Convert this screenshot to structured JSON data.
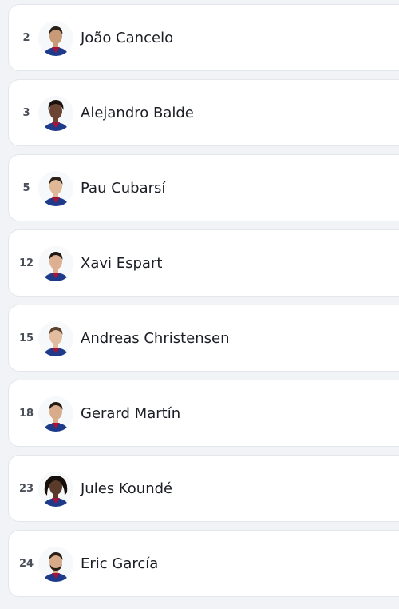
{
  "players": [
    {
      "number": "2",
      "name": "João Cancelo",
      "skin": "#c99a78",
      "hair": "#2a1e18"
    },
    {
      "number": "3",
      "name": "Alejandro Balde",
      "skin": "#6b4533",
      "hair": "#1a120e"
    },
    {
      "number": "5",
      "name": "Pau Cubarsí",
      "skin": "#e0b898",
      "hair": "#2c2019"
    },
    {
      "number": "12",
      "name": "Xavi Espart",
      "skin": "#dcb090",
      "hair": "#1f1713"
    },
    {
      "number": "15",
      "name": "Andreas Christensen",
      "skin": "#e2bc9e",
      "hair": "#5a4330"
    },
    {
      "number": "18",
      "name": "Gerard Martín",
      "skin": "#d8ab8a",
      "hair": "#241a14"
    },
    {
      "number": "23",
      "name": "Jules Koundé",
      "skin": "#5a3a2a",
      "hair": "#150e0a"
    },
    {
      "number": "24",
      "name": "Eric García",
      "skin": "#d6aa88",
      "hair": "#2a1f18"
    }
  ],
  "colors": {
    "kit_blue": "#1e3a8a",
    "kit_red": "#a5133a",
    "background": "#f1f3f6",
    "card": "#ffffff"
  },
  "icon": "player-headshot-icon"
}
